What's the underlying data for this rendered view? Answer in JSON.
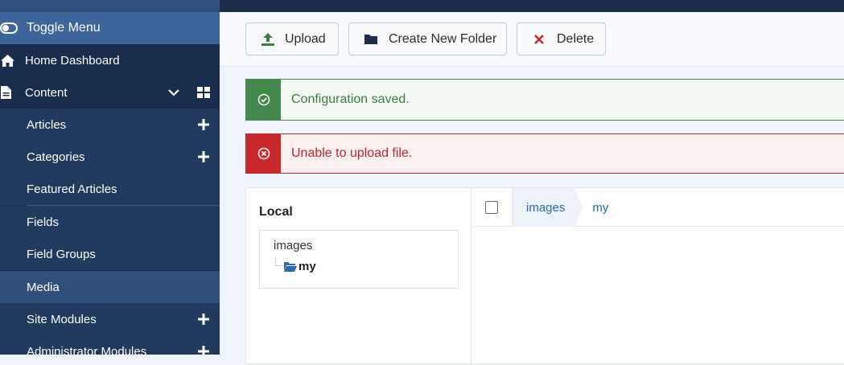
{
  "sidebar": {
    "toggle_label": "Toggle Menu",
    "home_label": "Home Dashboard",
    "content_label": "Content",
    "items": [
      {
        "label": "Articles",
        "has_add": true
      },
      {
        "label": "Categories",
        "has_add": true
      },
      {
        "label": "Featured Articles",
        "has_add": false
      },
      {
        "label": "Fields",
        "has_add": false
      },
      {
        "label": "Field Groups",
        "has_add": false
      },
      {
        "label": "Media",
        "has_add": false,
        "active": true
      },
      {
        "label": "Site Modules",
        "has_add": true
      },
      {
        "label": "Administrator Modules",
        "has_add": true
      }
    ]
  },
  "toolbar": {
    "upload_label": "Upload",
    "new_folder_label": "Create New Folder",
    "delete_label": "Delete"
  },
  "alerts": {
    "success": "Configuration saved.",
    "error": "Unable to upload file."
  },
  "media": {
    "tree_title": "Local",
    "tree_root": "images",
    "tree_child": "my",
    "breadcrumb": [
      "images",
      "my"
    ]
  },
  "colors": {
    "sidebar_bg": "#1a2d4c",
    "sidebar_active": "#3c659c",
    "success": "#44874a",
    "danger": "#c9282d",
    "link": "#2a69b8"
  },
  "icons": {
    "toggle": "toggle-icon",
    "home": "home-icon",
    "content": "file-icon",
    "upload": "upload-icon",
    "folder": "folder-icon",
    "delete": "x-icon",
    "success": "check-circle-icon",
    "error": "x-circle-icon"
  }
}
